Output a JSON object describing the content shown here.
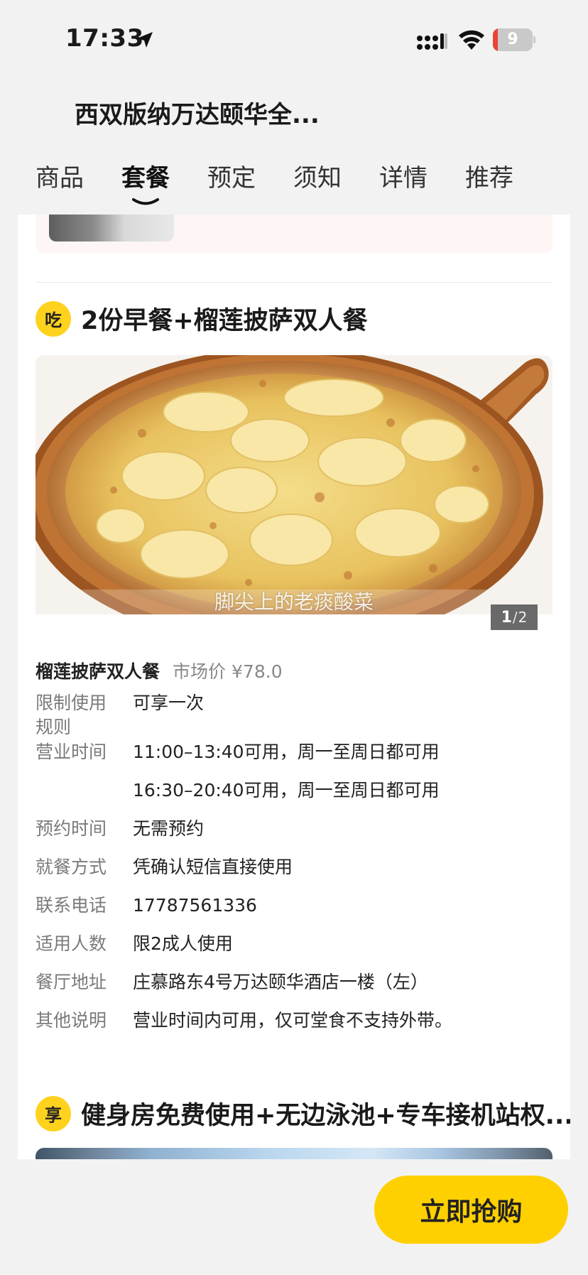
{
  "status_bar": {
    "time": "17:33",
    "battery": "9"
  },
  "header": {
    "title": "西双版纳万达颐华全..."
  },
  "tabs": [
    {
      "label": "商品"
    },
    {
      "label": "套餐"
    },
    {
      "label": "预定"
    },
    {
      "label": "须知"
    },
    {
      "label": "详情"
    },
    {
      "label": "推荐"
    }
  ],
  "active_tab": "套餐",
  "section1": {
    "badge": "吃",
    "title": "2份早餐+榴莲披萨双人餐",
    "image_caption": "脚尖上的老痰酸菜",
    "pager": {
      "current": "1",
      "separator": "/",
      "total": "2"
    }
  },
  "package": {
    "name": "榴莲披萨双人餐",
    "price_label": "市场价",
    "price": "¥78.0"
  },
  "info": [
    {
      "label": "限制使用规则",
      "value": "可享一次"
    },
    {
      "label": "营业时间",
      "value": "11:00–13:40可用，周一至周日都可用"
    },
    {
      "label": "",
      "value": "16:30–20:40可用，周一至周日都可用"
    },
    {
      "label": "预约时间",
      "value": "无需预约"
    },
    {
      "label": "就餐方式",
      "value": "凭确认短信直接使用"
    },
    {
      "label": "联系电话",
      "value": "17787561336"
    },
    {
      "label": "适用人数",
      "value": "限2成人使用"
    },
    {
      "label": "餐厅地址",
      "value": "庄慕路东4号万达颐华酒店一楼（左）"
    },
    {
      "label": "其他说明",
      "value": "营业时间内可用，仅可堂食不支持外带。"
    }
  ],
  "section2": {
    "badge": "享",
    "title": "健身房免费使用+无边泳池+专车接机站权..."
  },
  "buy_button": "立即抢购",
  "colors": {
    "accent": "#ffd000",
    "badge": "#ffd21e",
    "background": "#f2f2f2"
  }
}
